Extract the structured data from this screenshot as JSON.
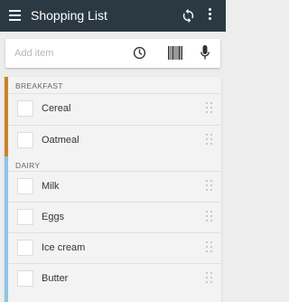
{
  "app": {
    "title": "Shopping List"
  },
  "add_bar": {
    "placeholder": "Add item"
  },
  "colors": {
    "appbar": "#2b3a42",
    "breakfast_accent": "#c8842a",
    "dairy_accent": "#8ec3e8"
  },
  "icons": [
    "hamburger-menu-icon",
    "sync-icon",
    "more-vert-icon",
    "clock-icon",
    "barcode-icon",
    "mic-icon",
    "drag-handle-icon"
  ],
  "sections": [
    {
      "name": "BREAKFAST",
      "items": [
        {
          "label": "Cereal"
        },
        {
          "label": "Oatmeal"
        }
      ]
    },
    {
      "name": "DAIRY",
      "items": [
        {
          "label": "Milk"
        },
        {
          "label": "Eggs"
        },
        {
          "label": "Ice cream"
        },
        {
          "label": "Butter"
        }
      ]
    }
  ]
}
